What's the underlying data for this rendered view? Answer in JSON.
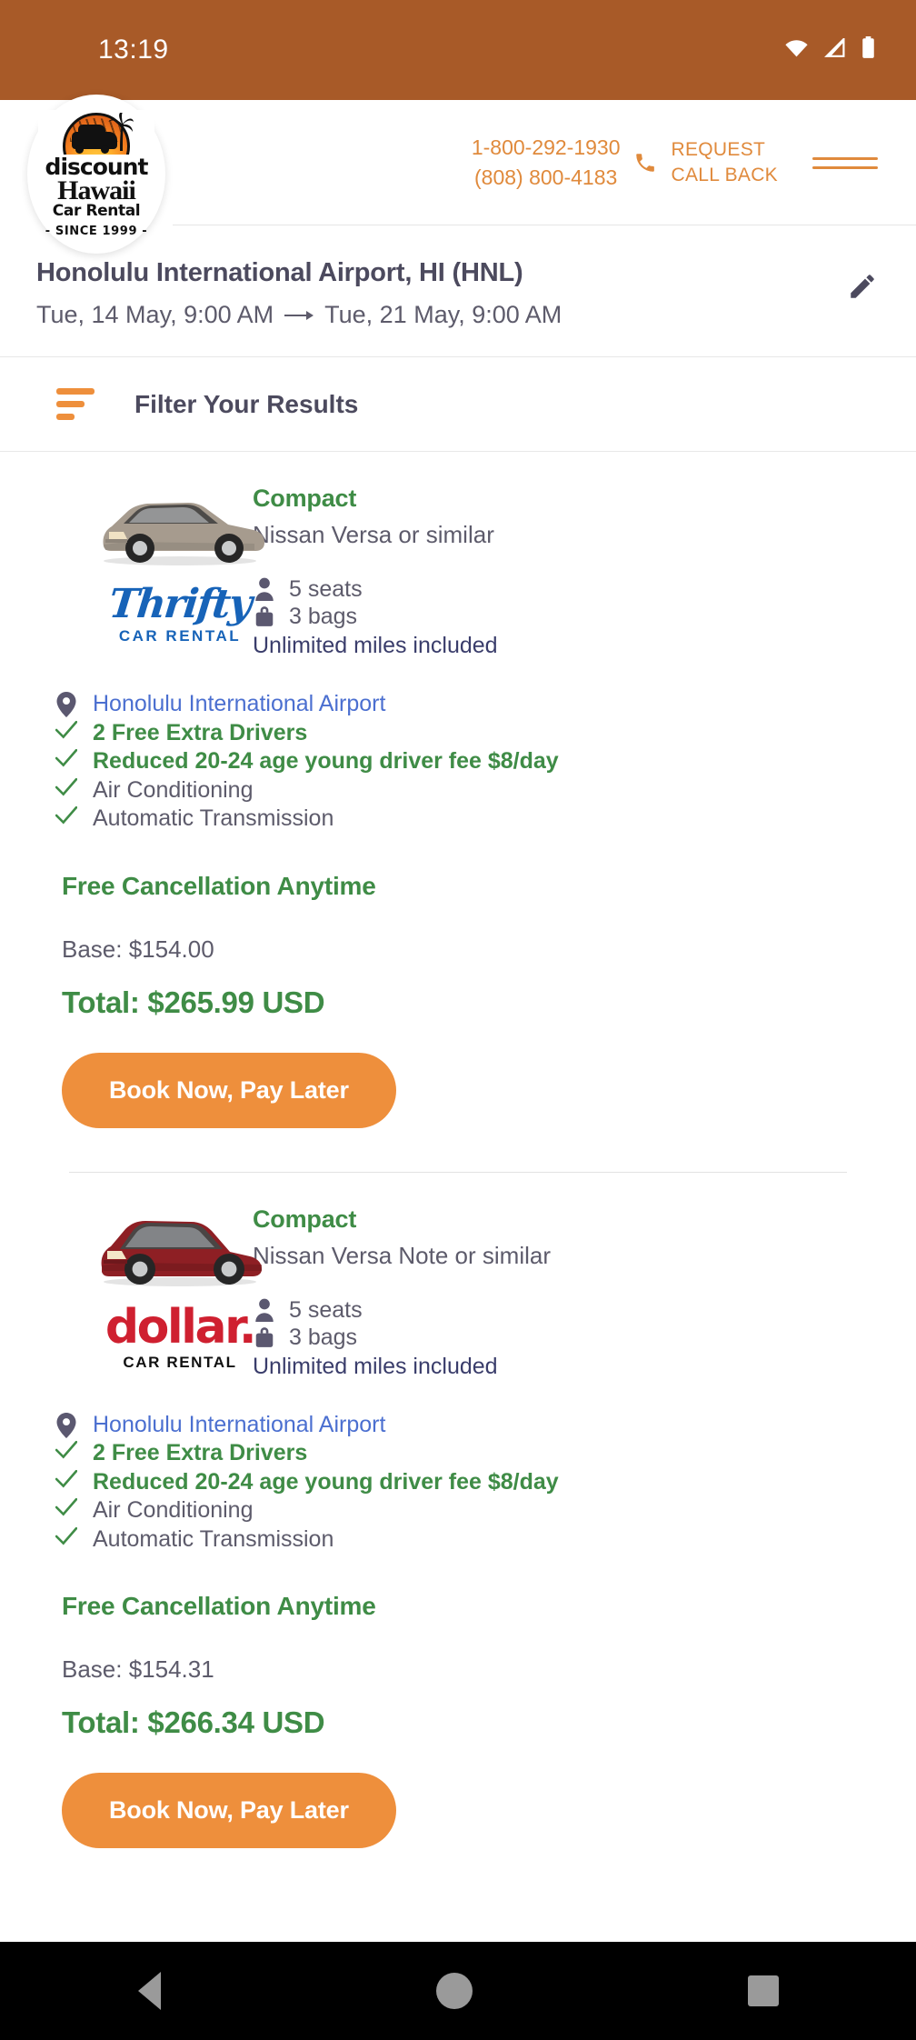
{
  "statusbar": {
    "time": "13:19",
    "icons": [
      "wifi-icon",
      "signal-icon",
      "battery-icon"
    ]
  },
  "header": {
    "logo": {
      "line1": "discount",
      "line2": "Hawaii",
      "line3": "Car Rental",
      "since": "- SINCE 1999 -"
    },
    "phone_primary": "1-800-292-1930",
    "phone_secondary": "(808) 800-4183",
    "phone_icon": "phone-icon",
    "callback_line1": "REQUEST",
    "callback_line2": "CALL BACK",
    "menu_icon": "hamburger-menu-icon",
    "accent_color": "#e08a3c"
  },
  "search": {
    "location": "Honolulu International Airport, HI (HNL)",
    "pickup": "Tue, 14 May,  9:00 AM",
    "dropoff": "Tue, 21 May,  9:00 AM",
    "arrow_icon": "arrow-right-icon",
    "edit_icon": "pencil-edit-icon"
  },
  "filter": {
    "label": "Filter Your Results",
    "icon": "filter-bars-icon"
  },
  "results": [
    {
      "brand": "Thrifty",
      "brand_sub": "CAR RENTAL",
      "brand_color": "#1763b8",
      "car_color": "#a69b8e",
      "car_body": "sedan",
      "class": "Compact",
      "model": "Nissan Versa or similar",
      "seats": "5 seats",
      "bags": "3 bags",
      "miles": "Unlimited miles included",
      "seat_icon": "person-icon",
      "bag_icon": "suitcase-icon",
      "pin_icon": "map-pin-icon",
      "location": "Honolulu International Airport",
      "features": [
        {
          "text": "2 Free Extra Drivers",
          "style": "hl",
          "icon": "check-icon"
        },
        {
          "text": "Reduced 20-24 age young driver fee $8/day",
          "style": "hl",
          "icon": "check-icon"
        },
        {
          "text": "Air Conditioning",
          "style": "plain",
          "icon": "check-icon"
        },
        {
          "text": "Automatic Transmission",
          "style": "plain",
          "icon": "check-icon"
        }
      ],
      "cancellation": "Free Cancellation Anytime",
      "base": "Base: $154.00",
      "total": "Total: $265.99 USD",
      "book_label": "Book Now, Pay Later"
    },
    {
      "brand": "dollar.",
      "brand_sub": "CAR RENTAL",
      "brand_color": "#cf2030",
      "car_color": "#8e1f24",
      "car_body": "hatchback",
      "class": "Compact",
      "model": "Nissan Versa Note or similar",
      "seats": "5 seats",
      "bags": "3 bags",
      "miles": "Unlimited miles included",
      "seat_icon": "person-icon",
      "bag_icon": "suitcase-icon",
      "pin_icon": "map-pin-icon",
      "location": "Honolulu International Airport",
      "features": [
        {
          "text": "2 Free Extra Drivers",
          "style": "hl",
          "icon": "check-icon"
        },
        {
          "text": "Reduced 20-24 age young driver fee $8/day",
          "style": "hl",
          "icon": "check-icon"
        },
        {
          "text": "Air Conditioning",
          "style": "plain",
          "icon": "check-icon"
        },
        {
          "text": "Automatic Transmission",
          "style": "plain",
          "icon": "check-icon"
        }
      ],
      "cancellation": "Free Cancellation Anytime",
      "base": "Base: $154.31",
      "total": "Total: $266.34 USD",
      "book_label": "Book Now, Pay Later"
    }
  ],
  "navbar": {
    "back_icon": "back-triangle-icon",
    "home_icon": "home-circle-icon",
    "recent_icon": "recent-square-icon"
  }
}
